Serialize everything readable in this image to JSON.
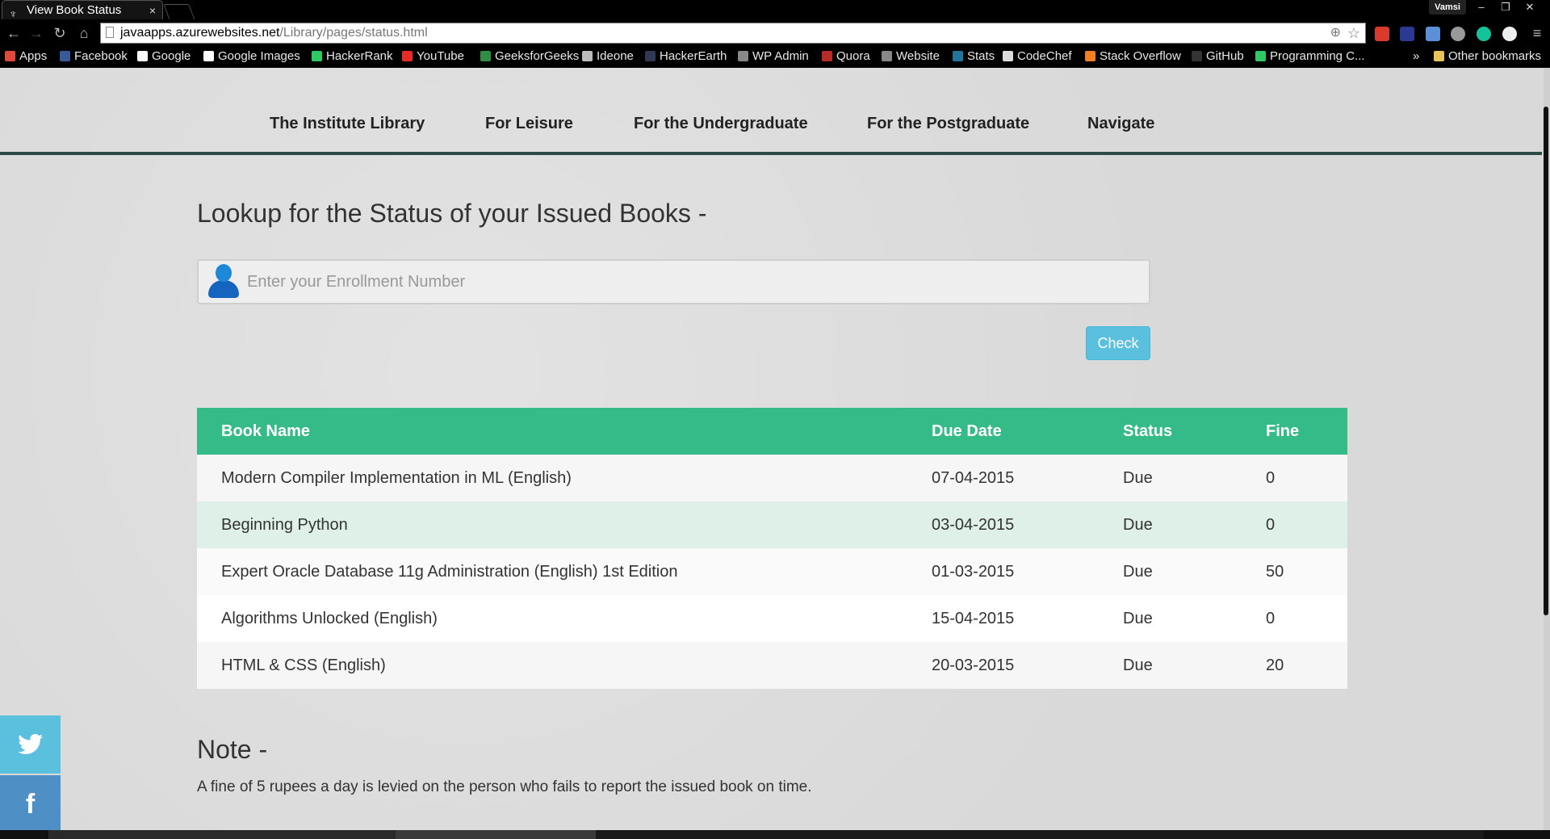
{
  "browser": {
    "tab_title": "View Book Status",
    "tab_close": "×",
    "profile_name": "Vamsi",
    "url_domain": "javaapps.azurewebsites.net",
    "url_path": "/Library/pages/status.html",
    "bookmarks": [
      {
        "label": "Apps",
        "icon_color": "#e04a3a"
      },
      {
        "label": "Facebook",
        "icon_color": "#3b5998"
      },
      {
        "label": "Google",
        "icon_color": "#ffffff"
      },
      {
        "label": "Google Images",
        "icon_color": "#ffffff"
      },
      {
        "label": "HackerRank",
        "icon_color": "#2ec866"
      },
      {
        "label": "YouTube",
        "icon_color": "#e52d27"
      },
      {
        "label": "GeeksforGeeks",
        "icon_color": "#2f8d46"
      },
      {
        "label": "Ideone",
        "icon_color": "#bbbbbb"
      },
      {
        "label": "HackerEarth",
        "icon_color": "#323754"
      },
      {
        "label": "WP Admin",
        "icon_color": "#888888"
      },
      {
        "label": "Quora",
        "icon_color": "#b92b27"
      },
      {
        "label": "Website",
        "icon_color": "#888888"
      },
      {
        "label": "Stats",
        "icon_color": "#21759b"
      },
      {
        "label": "CodeChef",
        "icon_color": "#dddddd"
      },
      {
        "label": "Stack Overflow",
        "icon_color": "#f48024"
      },
      {
        "label": "GitHub",
        "icon_color": "#333333"
      },
      {
        "label": "Programming C...",
        "icon_color": "#2ec866"
      }
    ],
    "overflow_chevron": "»",
    "other_bookmarks": "Other bookmarks"
  },
  "nav": {
    "items": [
      "The Institute Library",
      "For Leisure",
      "For the Undergraduate",
      "For the Postgraduate",
      "Navigate"
    ]
  },
  "main": {
    "heading": "Lookup for the Status of your Issued Books -",
    "enrollment_placeholder": "Enter your Enrollment Number",
    "check_label": "Check"
  },
  "table": {
    "headers": [
      "Book Name",
      "Due Date",
      "Status",
      "Fine"
    ],
    "rows": [
      [
        "Modern Compiler Implementation in ML (English)",
        "07-04-2015",
        "Due",
        "0"
      ],
      [
        "Beginning Python",
        "03-04-2015",
        "Due",
        "0"
      ],
      [
        "Expert Oracle Database 11g Administration (English) 1st Edition",
        "01-03-2015",
        "Due",
        "50"
      ],
      [
        "Algorithms Unlocked (English)",
        "15-04-2015",
        "Due",
        "0"
      ],
      [
        "HTML & CSS (English)",
        "20-03-2015",
        "Due",
        "20"
      ]
    ]
  },
  "note": {
    "title": "Note -",
    "text": "A fine of 5 rupees a day is levied on the person who fails to report the issued book on time."
  },
  "social": {
    "twitter_color": "#5bc0de",
    "facebook_color": "#4e8fc6",
    "facebook_glyph": "f"
  },
  "colors": {
    "table_header": "#35bb87",
    "check_button": "#5bc0de",
    "nav_underline": "#2e4a45"
  }
}
